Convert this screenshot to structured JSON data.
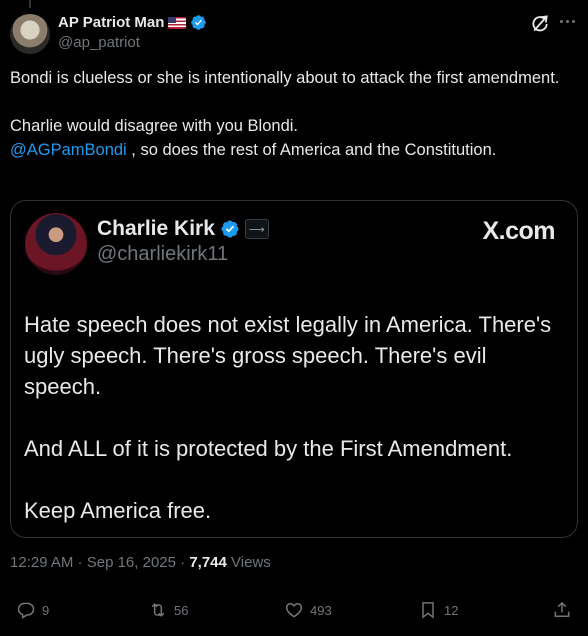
{
  "author": {
    "display_name": "AP Patriot Man",
    "handle": "@ap_patriot"
  },
  "tweet": {
    "line1": "Bondi is clueless or she is intentionally about to attack the first amendment.",
    "line2": "Charlie would disagree with you Blondi.",
    "mention": "@AGPamBondi",
    "line3_rest": " , so does the rest of America and the Constitution."
  },
  "embed": {
    "display_name": "Charlie Kirk",
    "handle": "@charliekirk11",
    "source": "X.com",
    "para1": "Hate speech does not exist legally in America. There's ugly speech. There's gross speech. There's evil speech.",
    "para2": "And ALL of it is protected by the First Amendment.",
    "para3": "Keep America free."
  },
  "meta": {
    "time": "12:29 AM",
    "sep1": " · ",
    "date": "Sep 16, 2025",
    "sep2": " · ",
    "views_count": "7,744",
    "views_label": " Views"
  },
  "actions": {
    "replies": "9",
    "reposts": "56",
    "likes": "493",
    "bookmarks": "12"
  },
  "colors": {
    "background": "#000000",
    "text": "#e7e9ea",
    "muted": "#71767b",
    "link": "#1d9bf0",
    "verified": "#1d9bf0"
  },
  "icons": [
    "verified-badge-icon",
    "us-flag-icon",
    "grok-icon",
    "more-icon",
    "reply-icon",
    "repost-icon",
    "like-icon",
    "bookmark-icon",
    "share-icon",
    "affiliate-badge-icon"
  ]
}
